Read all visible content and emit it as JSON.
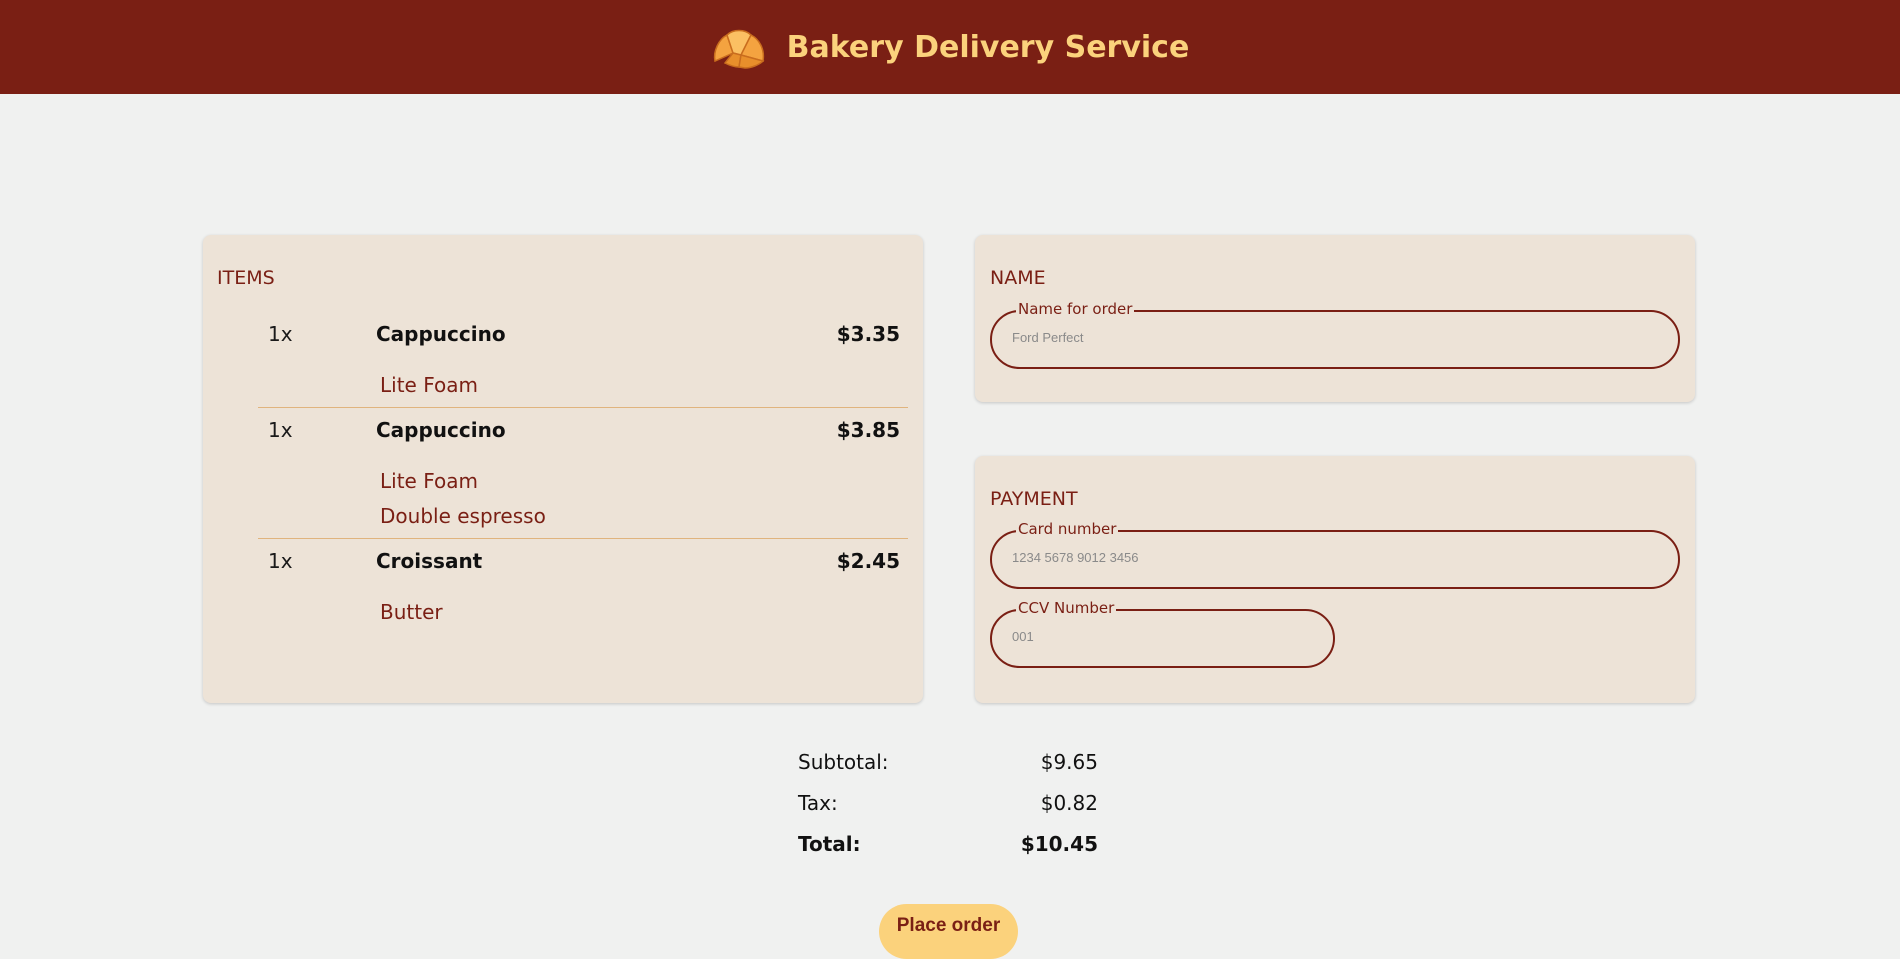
{
  "header": {
    "title": "Bakery Delivery Service",
    "logo_icon": "croissant-icon"
  },
  "items_section": {
    "title": "ITEMS",
    "items": [
      {
        "qty": "1x",
        "name": "Cappuccino",
        "price": "$3.35",
        "modifiers": [
          "Lite Foam"
        ]
      },
      {
        "qty": "1x",
        "name": "Cappuccino",
        "price": "$3.85",
        "modifiers": [
          "Lite Foam",
          "Double espresso"
        ]
      },
      {
        "qty": "1x",
        "name": "Croissant",
        "price": "$2.45",
        "modifiers": [
          "Butter"
        ]
      }
    ]
  },
  "name_section": {
    "title": "NAME",
    "name_field": {
      "label": "Name for order",
      "placeholder": "Ford Perfect",
      "value": ""
    }
  },
  "payment_section": {
    "title": "PAYMENT",
    "card_field": {
      "label": "Card number",
      "placeholder": "1234 5678 9012 3456",
      "value": ""
    },
    "ccv_field": {
      "label": "CCV Number",
      "placeholder": "001",
      "value": ""
    }
  },
  "totals": {
    "subtotal_label": "Subtotal:",
    "subtotal_value": "$9.65",
    "tax_label": "Tax:",
    "tax_value": "$0.82",
    "total_label": "Total:",
    "total_value": "$10.45"
  },
  "place_order_label": "Place order",
  "colors": {
    "header_bg": "#7a1f14",
    "accent_yellow": "#fbd27c",
    "card_bg": "#ede3d7",
    "page_bg": "#f0f1f0",
    "divider": "#e0b47e"
  }
}
